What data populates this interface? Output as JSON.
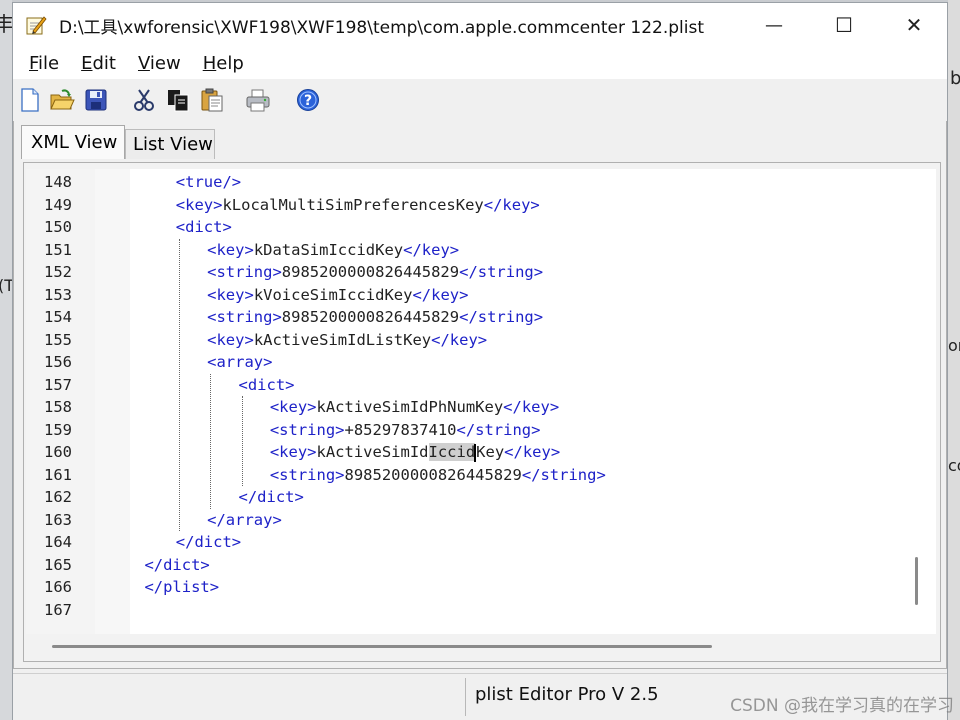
{
  "window": {
    "title": "D:\\工具\\xwforensic\\XWF198\\XWF198\\temp\\com.apple.commcenter 122.plist",
    "minimize_glyph": "—",
    "maximize_glyph": "☐",
    "close_glyph": "✕"
  },
  "menu": {
    "items": [
      {
        "label": "File",
        "accel": "F",
        "rest": "ile"
      },
      {
        "label": "Edit",
        "accel": "E",
        "rest": "dit"
      },
      {
        "label": "View",
        "accel": "V",
        "rest": "iew"
      },
      {
        "label": "Help",
        "accel": "H",
        "rest": "elp"
      }
    ]
  },
  "toolbar": {
    "buttons": [
      "new-file-icon",
      "open-folder-icon",
      "save-icon",
      "cut-icon",
      "copy-icon",
      "paste-icon",
      "print-icon",
      "help-icon"
    ]
  },
  "tabs": {
    "xml_view": "XML View",
    "list_view": "List View"
  },
  "editor": {
    "lines": [
      {
        "n": "148",
        "indent": 4,
        "parts": [
          [
            "tag",
            "<true/>"
          ]
        ]
      },
      {
        "n": "149",
        "indent": 4,
        "parts": [
          [
            "tag",
            "<key>"
          ],
          [
            "txt",
            "kLocalMultiSimPreferencesKey"
          ],
          [
            "tag",
            "</key>"
          ]
        ]
      },
      {
        "n": "150",
        "indent": 4,
        "parts": [
          [
            "tag",
            "<dict>"
          ]
        ]
      },
      {
        "n": "151",
        "indent": 7,
        "parts": [
          [
            "tag",
            "<key>"
          ],
          [
            "txt",
            "kDataSimIccidKey"
          ],
          [
            "tag",
            "</key>"
          ]
        ]
      },
      {
        "n": "152",
        "indent": 7,
        "parts": [
          [
            "tag",
            "<string>"
          ],
          [
            "txt",
            "89852000008264458​29"
          ],
          [
            "tag",
            "</string>"
          ]
        ]
      },
      {
        "n": "153",
        "indent": 7,
        "parts": [
          [
            "tag",
            "<key>"
          ],
          [
            "txt",
            "kVoiceSimIccidKey"
          ],
          [
            "tag",
            "</key>"
          ]
        ]
      },
      {
        "n": "154",
        "indent": 7,
        "parts": [
          [
            "tag",
            "<string>"
          ],
          [
            "txt",
            "8985200000826445829"
          ],
          [
            "tag",
            "</string>"
          ]
        ]
      },
      {
        "n": "155",
        "indent": 7,
        "parts": [
          [
            "tag",
            "<key>"
          ],
          [
            "txt",
            "kActiveSimIdListKey"
          ],
          [
            "tag",
            "</key>"
          ]
        ]
      },
      {
        "n": "156",
        "indent": 7,
        "parts": [
          [
            "tag",
            "<array>"
          ]
        ]
      },
      {
        "n": "157",
        "indent": 10,
        "parts": [
          [
            "tag",
            "<dict>"
          ]
        ]
      },
      {
        "n": "158",
        "indent": 13,
        "parts": [
          [
            "tag",
            "<key>"
          ],
          [
            "txt",
            "kActiveSimIdPhNumKey"
          ],
          [
            "tag",
            "</key>"
          ]
        ]
      },
      {
        "n": "159",
        "indent": 13,
        "parts": [
          [
            "tag",
            "<string>"
          ],
          [
            "txt",
            "+85297837410"
          ],
          [
            "tag",
            "</string>"
          ]
        ]
      },
      {
        "n": "160",
        "indent": 13,
        "parts": [
          [
            "tag",
            "<key>"
          ],
          [
            "txt",
            "kActiveSimId"
          ],
          [
            "hl",
            "Iccid"
          ],
          [
            "caret",
            ""
          ],
          [
            "txt",
            "Key"
          ],
          [
            "tag",
            "</key>"
          ]
        ]
      },
      {
        "n": "161",
        "indent": 13,
        "parts": [
          [
            "tag",
            "<string>"
          ],
          [
            "txt",
            "8985200000826445829"
          ],
          [
            "tag",
            "</string>"
          ]
        ]
      },
      {
        "n": "162",
        "indent": 10,
        "parts": [
          [
            "tag",
            "</dict>"
          ]
        ]
      },
      {
        "n": "163",
        "indent": 7,
        "parts": [
          [
            "tag",
            "</array>"
          ]
        ]
      },
      {
        "n": "164",
        "indent": 4,
        "parts": [
          [
            "tag",
            "</dict>"
          ]
        ]
      },
      {
        "n": "165",
        "indent": 1,
        "parts": [
          [
            "tag",
            "</dict>"
          ]
        ]
      },
      {
        "n": "166",
        "indent": 1,
        "parts": [
          [
            "tag",
            "</plist>"
          ]
        ]
      },
      {
        "n": "167",
        "indent": 0,
        "parts": []
      }
    ]
  },
  "status": {
    "app_version": "plist Editor Pro V 2.5"
  },
  "watermark": "CSDN @我在学习真的在学习",
  "background_fragments": {
    "left_top": "丰",
    "left_mid": "(T",
    "right_b": "b",
    "right_or": "or",
    "right_co": "co"
  },
  "colors": {
    "tag": "#1e22c8",
    "text": "#222222",
    "highlight": "#cfcfcf"
  }
}
